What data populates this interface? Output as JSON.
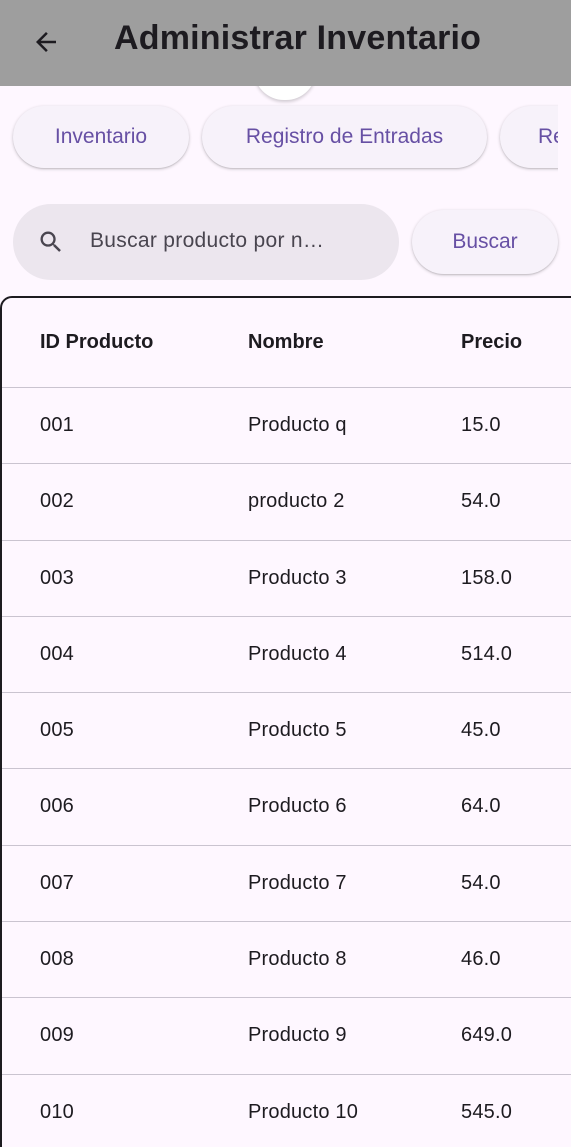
{
  "appbar": {
    "title": "Administrar Inventario",
    "back_icon": "arrow-back-icon",
    "background": "#9e9e9e"
  },
  "tabs": [
    {
      "label": "Inventario"
    },
    {
      "label": "Registro de Entradas"
    },
    {
      "label": "Re"
    }
  ],
  "search": {
    "placeholder": "Buscar producto por n…",
    "icon": "search-icon",
    "button_label": "Buscar"
  },
  "accent_color": "#6750a4",
  "table": {
    "headers": [
      "ID Producto",
      "Nombre",
      "Precio"
    ],
    "rows": [
      [
        "001",
        "Producto q",
        "15.0"
      ],
      [
        "002",
        "producto 2",
        "54.0"
      ],
      [
        "003",
        "Producto 3",
        "158.0"
      ],
      [
        "004",
        "Producto 4",
        "514.0"
      ],
      [
        "005",
        "Producto 5",
        "45.0"
      ],
      [
        "006",
        "Producto 6",
        "64.0"
      ],
      [
        "007",
        "Producto 7",
        "54.0"
      ],
      [
        "008",
        "Producto 8",
        "46.0"
      ],
      [
        "009",
        "Producto 9",
        "649.0"
      ],
      [
        "010",
        "Producto 10",
        "545.0"
      ]
    ]
  }
}
